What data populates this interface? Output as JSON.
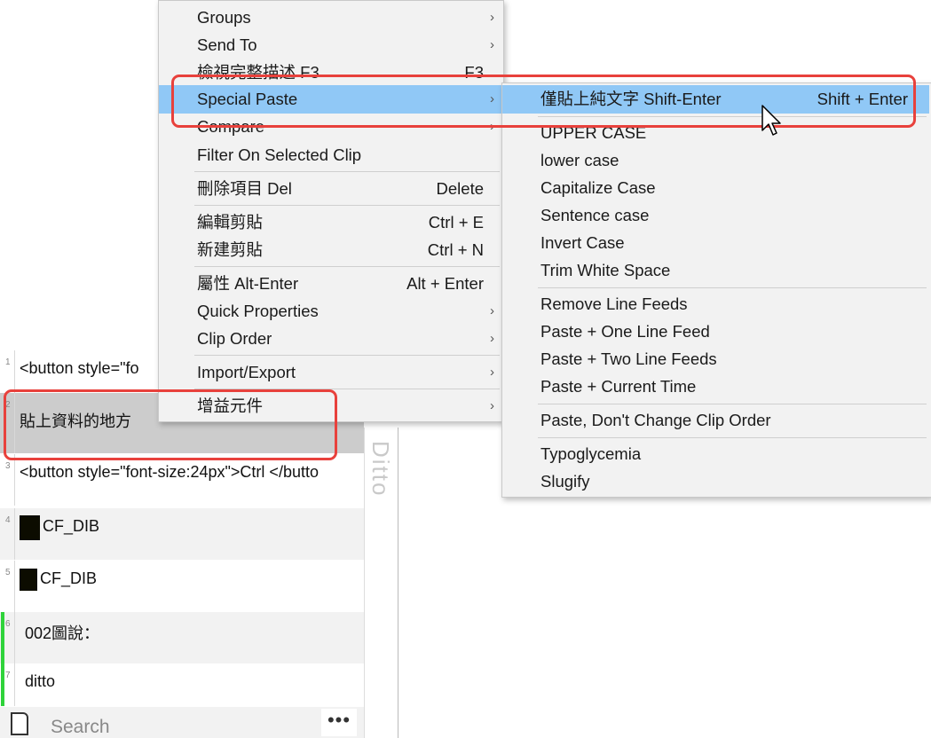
{
  "clips": [
    {
      "num": "1",
      "text": "<button style=\"fo"
    },
    {
      "num": "2",
      "text": "貼上資料的地方"
    },
    {
      "num": "3",
      "text": "<button style=\"font-size:24px\">Ctrl </butto"
    },
    {
      "num": "4",
      "text": "CF_DIB"
    },
    {
      "num": "5",
      "text": "CF_DIB"
    },
    {
      "num": "6",
      "text": "002圖說："
    },
    {
      "num": "7",
      "text": "ditto"
    }
  ],
  "sidebar_label": "Ditto",
  "search": {
    "placeholder": "Search",
    "more": "•••"
  },
  "main_menu": [
    {
      "label": "Groups",
      "shortcut": "",
      "arrow": "›"
    },
    {
      "label": "Send To",
      "shortcut": "",
      "arrow": "›"
    },
    {
      "label": "檢視完整描述 F3",
      "shortcut": "F3",
      "arrow": ""
    },
    {
      "label": "Special Paste",
      "shortcut": "",
      "arrow": "›"
    },
    {
      "label": "Compare",
      "shortcut": "",
      "arrow": "›"
    },
    {
      "label": "Filter On Selected Clip",
      "shortcut": "",
      "arrow": ""
    },
    {
      "label": "刪除項目 Del",
      "shortcut": "Delete",
      "arrow": ""
    },
    {
      "label": "編輯剪貼",
      "shortcut": "Ctrl + E",
      "arrow": ""
    },
    {
      "label": "新建剪貼",
      "shortcut": "Ctrl + N",
      "arrow": ""
    },
    {
      "label": "屬性 Alt-Enter",
      "shortcut": "Alt + Enter",
      "arrow": ""
    },
    {
      "label": "Quick Properties",
      "shortcut": "",
      "arrow": "›"
    },
    {
      "label": "Clip Order",
      "shortcut": "",
      "arrow": "›"
    },
    {
      "label": "Import/Export",
      "shortcut": "",
      "arrow": "›"
    },
    {
      "label": "增益元件",
      "shortcut": "",
      "arrow": "›"
    }
  ],
  "sub_menu": [
    {
      "label": "僅貼上純文字 Shift-Enter",
      "shortcut": "Shift + Enter"
    },
    {
      "label": "UPPER CASE",
      "shortcut": ""
    },
    {
      "label": "lower case",
      "shortcut": ""
    },
    {
      "label": "Capitalize Case",
      "shortcut": ""
    },
    {
      "label": "Sentence case",
      "shortcut": ""
    },
    {
      "label": "Invert Case",
      "shortcut": ""
    },
    {
      "label": "Trim White Space",
      "shortcut": ""
    },
    {
      "label": "Remove Line Feeds",
      "shortcut": ""
    },
    {
      "label": "Paste + One Line Feed",
      "shortcut": ""
    },
    {
      "label": "Paste + Two Line Feeds",
      "shortcut": ""
    },
    {
      "label": "Paste + Current Time",
      "shortcut": ""
    },
    {
      "label": "Paste, Don't Change Clip Order",
      "shortcut": ""
    },
    {
      "label": "Typoglycemia",
      "shortcut": ""
    },
    {
      "label": "Slugify",
      "shortcut": ""
    }
  ],
  "colors": {
    "highlight": "#90c8f6",
    "annotation": "#e8413c",
    "green": "#2fd33a"
  }
}
